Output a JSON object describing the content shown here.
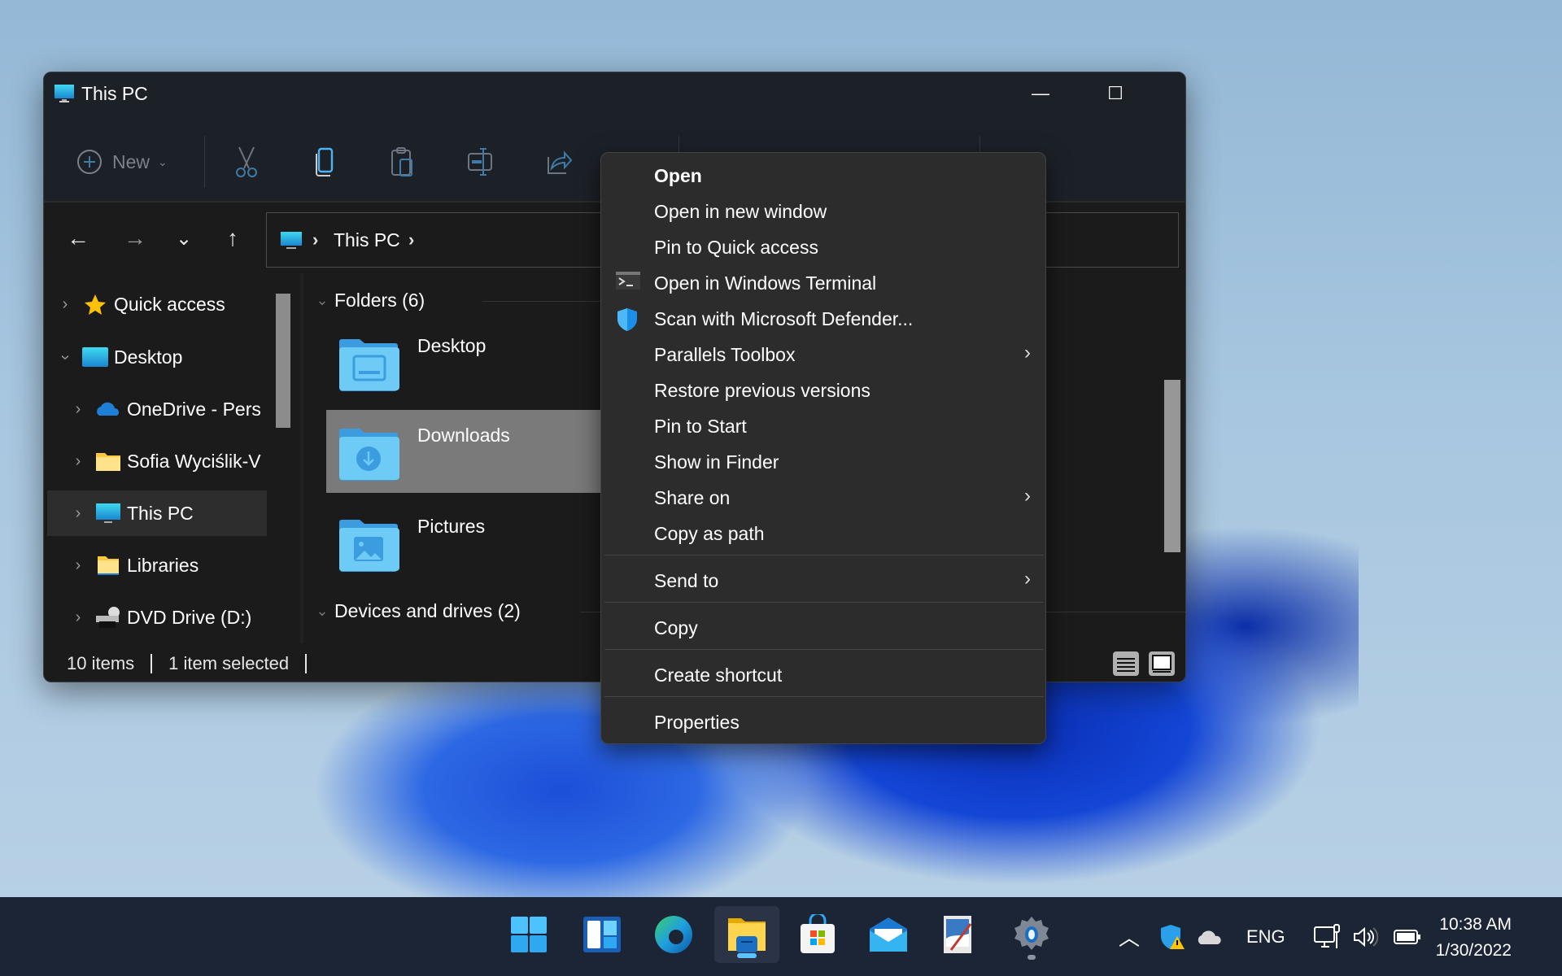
{
  "window": {
    "title": "This PC",
    "controls": {
      "minimize": "—",
      "maximize": "☐",
      "close": "✕"
    },
    "toolbar": {
      "new_label": "New",
      "buttons": [
        "cut",
        "copy",
        "paste",
        "rename",
        "share"
      ]
    },
    "nav": {
      "back": "←",
      "forward": "→",
      "recent": "⌄",
      "up": "↑"
    },
    "address": {
      "segments": [
        "This PC"
      ],
      "separator": "›"
    },
    "navpane": {
      "items": [
        {
          "label": "Quick access",
          "icon": "star-icon",
          "expanded": false,
          "selected": false
        },
        {
          "label": "Desktop",
          "icon": "desktop-icon",
          "expanded": true,
          "selected": false
        },
        {
          "label": "OneDrive - Pers",
          "icon": "onedrive-icon",
          "expanded": false,
          "selected": false
        },
        {
          "label": "Sofia Wyciślik-V",
          "icon": "folder-icon",
          "expanded": false,
          "selected": false
        },
        {
          "label": "This PC",
          "icon": "pc-icon",
          "expanded": false,
          "selected": true
        },
        {
          "label": "Libraries",
          "icon": "libraries-icon",
          "expanded": false,
          "selected": false
        },
        {
          "label": "DVD Drive (D:)",
          "icon": "dvd-icon",
          "expanded": false,
          "selected": false
        }
      ]
    },
    "content": {
      "groups": [
        {
          "label": "Folders (6)"
        },
        {
          "label": "Devices and drives (2)"
        }
      ],
      "folders": [
        {
          "label": "Desktop",
          "selected": false
        },
        {
          "label": "Downloads",
          "selected": true
        },
        {
          "label": "Pictures",
          "selected": false
        }
      ]
    },
    "status": {
      "items": "10 items",
      "selected": "1 item selected"
    }
  },
  "context_menu": {
    "items": [
      {
        "label": "Open",
        "bold": true
      },
      {
        "label": "Open in new window"
      },
      {
        "label": "Pin to Quick access"
      },
      {
        "label": "Open in Windows Terminal",
        "icon": "terminal-icon"
      },
      {
        "label": "Scan with Microsoft Defender...",
        "icon": "defender-shield-icon"
      },
      {
        "label": "Parallels Toolbox",
        "submenu": true
      },
      {
        "label": "Restore previous versions"
      },
      {
        "label": "Pin to Start"
      },
      {
        "label": "Show in Finder"
      },
      {
        "label": "Share on",
        "submenu": true
      },
      {
        "label": "Copy as path"
      },
      {
        "label": "Send to",
        "submenu": true
      },
      {
        "label": "Copy"
      },
      {
        "label": "Create shortcut"
      },
      {
        "label": "Properties"
      }
    ],
    "submenu_arrow": "›"
  },
  "taskbar": {
    "apps": [
      "start",
      "widgets",
      "edge",
      "file-explorer",
      "store",
      "mail",
      "paint",
      "settings"
    ],
    "active_app": "file-explorer",
    "tray": {
      "language": "ENG",
      "time": "10:38 AM",
      "date": "1/30/2022"
    }
  },
  "colors": {
    "accent": "#5ec2ff",
    "folder_blue": "#6ecbf5",
    "selection": "#7a7a7a"
  }
}
